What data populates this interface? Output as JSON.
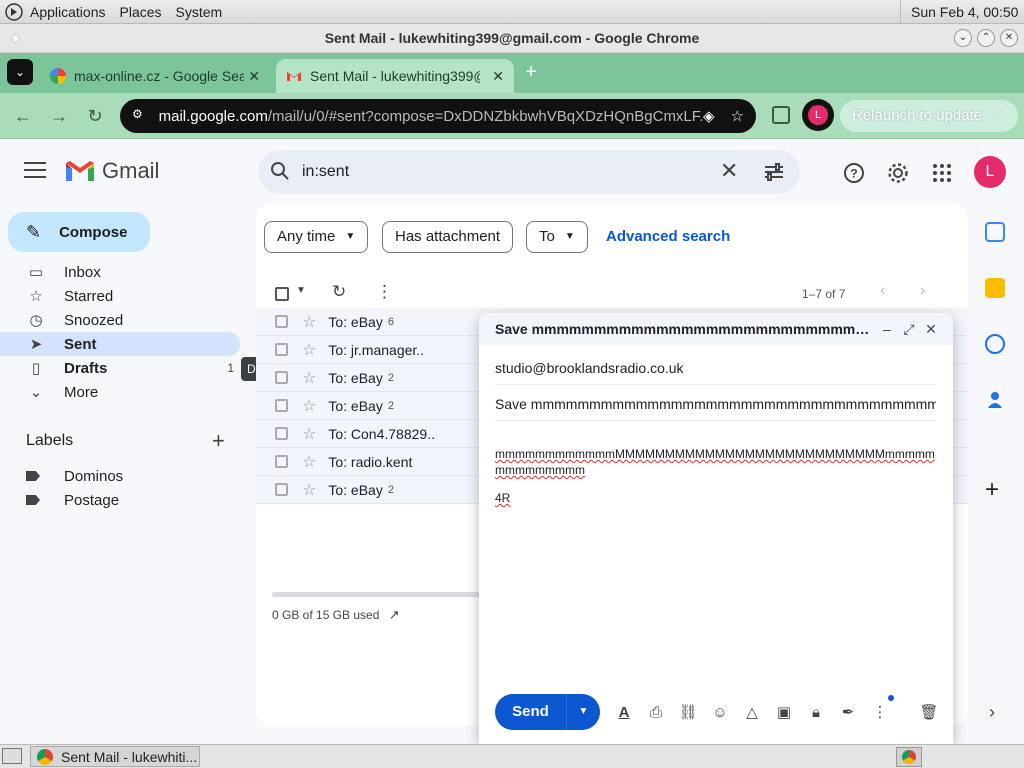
{
  "os_panel": {
    "menus": [
      "Applications",
      "Places",
      "System"
    ],
    "clock": "Sun Feb  4, 00:50"
  },
  "window": {
    "title": "Sent Mail - lukewhiting399@gmail.com - Google Chrome"
  },
  "tabs": [
    {
      "label": "max-online.cz - Google Sea",
      "favicon": "google-icon"
    },
    {
      "label": "Sent Mail - lukewhiting399@",
      "favicon": "gmail-icon"
    }
  ],
  "toolbar": {
    "url_host": "mail.google.com",
    "url_rest": "/mail/u/0/#sent?compose=DxDDNZbkbwhVBqXDzHQnBgCmxLF...",
    "avatar_letter": "L",
    "relaunch_label": "Relaunch to update"
  },
  "gmail": {
    "wordmark": "Gmail",
    "search_query": "in:sent",
    "avatar_letter": "L",
    "compose_label": "Compose",
    "nav": [
      {
        "label": "Inbox",
        "icon": "inbox-icon"
      },
      {
        "label": "Starred",
        "icon": "star-icon"
      },
      {
        "label": "Snoozed",
        "icon": "clock-icon"
      },
      {
        "label": "Sent",
        "icon": "send-icon"
      },
      {
        "label": "Drafts",
        "icon": "draft-icon",
        "count": "1"
      },
      {
        "label": "More",
        "icon": "chevron-down-icon"
      }
    ],
    "tooltip": "Drafts",
    "labels_heading": "Labels",
    "labels": [
      "Dominos",
      "Postage"
    ],
    "filters": {
      "any_time": "Any time",
      "has_attachment": "Has attachment",
      "to": "To",
      "advanced_search": "Advanced search"
    },
    "pager": "1–7 of 7",
    "rows": [
      {
        "to": "To: eBay",
        "count": "6"
      },
      {
        "to": "To: jr.manager..",
        "count": ""
      },
      {
        "to": "To: eBay",
        "count": "2"
      },
      {
        "to": "To: eBay",
        "count": "2"
      },
      {
        "to": "To: Con4.78829..",
        "count": ""
      },
      {
        "to": "To: radio.kent",
        "count": ""
      },
      {
        "to": "To: eBay",
        "count": "2"
      }
    ],
    "storage": "0 GB of 15 GB used"
  },
  "compose": {
    "title": "Save mmmmmmmmmmmmmmmmmmmmmmmmmmmm...",
    "to": "studio@brooklandsradio.co.uk",
    "subject": "Save mmmmmmmmmmmmmmmmmmmmmmmmmmmmmmmmmmmmmmmmmmmmmm",
    "body_line1": "mmmmmmmmmmmmMMMMMMMMMMMMMMMMMMMMMMMMMMMmmmmmmmmmmmmmm",
    "body_line2": "4R",
    "send_label": "Send"
  },
  "taskbar": {
    "task_label": "Sent Mail - lukewhiti..."
  },
  "colors": {
    "tabstrip": "#7cc59b",
    "toolbar": "#a9dcb8",
    "compose_accent": "#c2e7ff",
    "send_blue": "#0b57d0",
    "avatar_pink": "#e52b6a"
  }
}
